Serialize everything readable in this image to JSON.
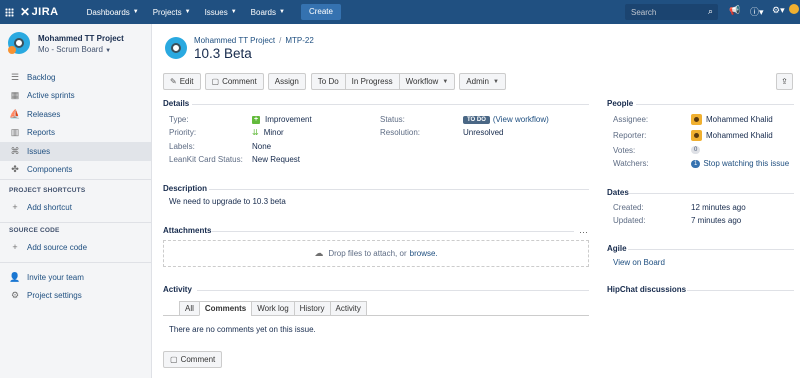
{
  "topnav": {
    "logo": "JIRA",
    "menus": [
      "Dashboards",
      "Projects",
      "Issues",
      "Boards"
    ],
    "create_label": "Create",
    "search_placeholder": "Search"
  },
  "sidebar": {
    "project_name": "Mohammed TT Project",
    "board_name": "Mo - Scrum Board",
    "items": [
      {
        "label": "Backlog",
        "icon": "backlog-icon"
      },
      {
        "label": "Active sprints",
        "icon": "sprint-icon"
      },
      {
        "label": "Releases",
        "icon": "ship-icon"
      },
      {
        "label": "Reports",
        "icon": "chart-icon"
      },
      {
        "label": "Issues",
        "icon": "issues-icon"
      },
      {
        "label": "Components",
        "icon": "puzzle-icon"
      }
    ],
    "shortcuts_heading": "PROJECT SHORTCUTS",
    "add_shortcut": "Add shortcut",
    "source_heading": "SOURCE CODE",
    "add_source": "Add source code",
    "invite": "Invite your team",
    "settings": "Project settings"
  },
  "issue": {
    "breadcrumb_project": "Mohammed TT Project",
    "breadcrumb_key": "MTP-22",
    "title": "10.3 Beta"
  },
  "toolbar": {
    "edit": "Edit",
    "comment": "Comment",
    "assign": "Assign",
    "todo": "To Do",
    "in_progress": "In Progress",
    "workflow": "Workflow",
    "admin": "Admin"
  },
  "details": {
    "heading": "Details",
    "type_label": "Type:",
    "type_value": "Improvement",
    "priority_label": "Priority:",
    "priority_value": "Minor",
    "labels_label": "Labels:",
    "labels_value": "None",
    "leankit_label": "LeanKit Card Status:",
    "leankit_value": "New Request",
    "status_label": "Status:",
    "status_value": "TO DO",
    "view_workflow": "(View workflow)",
    "resolution_label": "Resolution:",
    "resolution_value": "Unresolved"
  },
  "description": {
    "heading": "Description",
    "text": "We need to upgrade to 10.3 beta"
  },
  "attachments": {
    "heading": "Attachments",
    "drop_text": "Drop files to attach, or",
    "browse": "browse."
  },
  "activity": {
    "heading": "Activity",
    "tabs": [
      "All",
      "Comments",
      "Work log",
      "History",
      "Activity"
    ],
    "active_tab": "Comments",
    "empty": "There are no comments yet on this issue.",
    "comment_button": "Comment"
  },
  "people": {
    "heading": "People",
    "assignee_label": "Assignee:",
    "assignee": "Mohammed Khalid",
    "reporter_label": "Reporter:",
    "reporter": "Mohammed Khalid",
    "votes_label": "Votes:",
    "votes": "0",
    "watchers_label": "Watchers:",
    "watchers_count": "1",
    "stop_watching": "Stop watching this issue"
  },
  "dates": {
    "heading": "Dates",
    "created_label": "Created:",
    "created": "12 minutes ago",
    "updated_label": "Updated:",
    "updated": "7 minutes ago"
  },
  "agile": {
    "heading": "Agile",
    "view_on_board": "View on Board"
  },
  "hipchat": {
    "heading": "HipChat discussions"
  }
}
